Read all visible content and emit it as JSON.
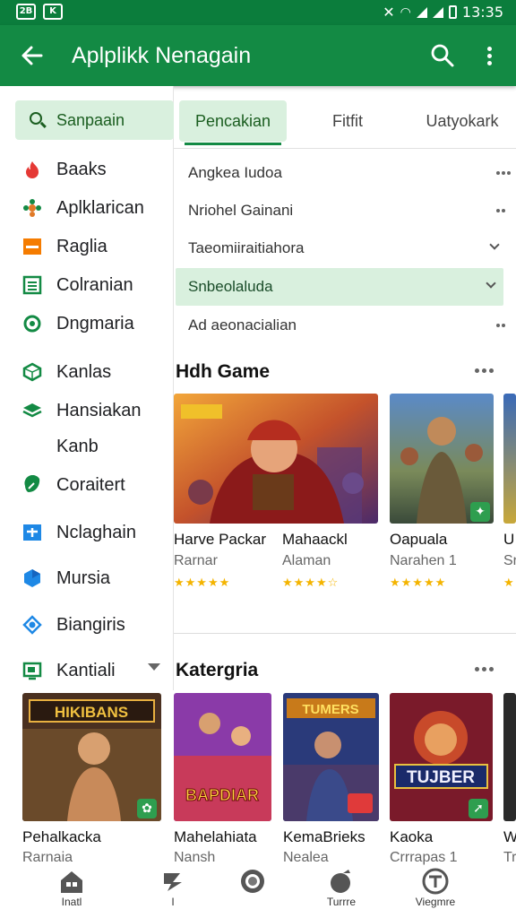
{
  "status_bar": {
    "left_icon_1": "2B",
    "left_icon_2": "K",
    "time": "13:35"
  },
  "app_bar": {
    "title": "Aplplikk Nenagain",
    "back_icon": "arrow-left-icon",
    "search_icon": "search-icon",
    "more_icon": "more-vert-icon"
  },
  "sidebar": {
    "search_label": "Sanpaain",
    "items": [
      {
        "label": "Baaks",
        "icon": "fire-icon",
        "color": "#e53935"
      },
      {
        "label": "Aplklarican",
        "icon": "flower-icon",
        "color": "#e07a27"
      },
      {
        "label": "Raglia",
        "icon": "minus-box-icon",
        "color": "#f57c00"
      },
      {
        "label": "Colranian",
        "icon": "list-icon",
        "color": "#138a44"
      },
      {
        "label": "Dngmaria",
        "icon": "circle-refresh-icon",
        "color": "#138a44"
      },
      {
        "label": "Kanlas",
        "icon": "cube-icon",
        "color": "#138a44"
      },
      {
        "label": "Hansiakan",
        "icon": "layers-icon",
        "color": "#138a44"
      },
      {
        "label": "Kanb",
        "icon": "",
        "color": ""
      },
      {
        "label": "Coraitert",
        "icon": "leaf-icon",
        "color": "#138a44"
      },
      {
        "label": "Nclaghain",
        "icon": "plus-box-icon",
        "color": "#1e88e5"
      },
      {
        "label": "Mursia",
        "icon": "hexagon-icon",
        "color": "#1e88e5"
      },
      {
        "label": "Biangiris",
        "icon": "diamond-eye-icon",
        "color": "#1e88e5"
      },
      {
        "label": "Kantiali",
        "icon": "monitor-icon",
        "color": "#138a44"
      }
    ]
  },
  "tabs": [
    {
      "label": "Pencakian",
      "active": true
    },
    {
      "label": "Fitfit",
      "active": false
    },
    {
      "label": "Uatyokark",
      "active": false
    }
  ],
  "filters": [
    {
      "label": "Angkea Iudoa",
      "control": "dots"
    },
    {
      "label": "Nriohel Gainani",
      "control": "dots"
    },
    {
      "label": "Taeomiiraitiahora",
      "control": "chevron"
    },
    {
      "label": "Snbeolaluda",
      "control": "chevron",
      "selected": true
    },
    {
      "label": "Ad aeonacialian",
      "control": "dots"
    }
  ],
  "section1": {
    "title": "Hdh Game",
    "cards": [
      {
        "name": "Harve Packar",
        "sub": "Rarnar",
        "stars": "★★★★★"
      },
      {
        "name": "Mahaackl",
        "sub": "Alaman",
        "stars": "★★★★☆"
      },
      {
        "name": "Oapuala",
        "sub": "Narahen 1",
        "stars": "★★★★★"
      },
      {
        "name": "U",
        "sub": "Sr",
        "stars": "★"
      }
    ]
  },
  "section2": {
    "title": "Katergria",
    "cards": [
      {
        "name": "Pehalkacka",
        "sub": "Rarnaia",
        "art_text": "HIKIBANS"
      },
      {
        "name": "Mahelahiata",
        "sub": "Nansh",
        "art_text": "BAPDIAR"
      },
      {
        "name": "KemaBrieks",
        "sub": "Nealea",
        "art_text": "TUMERS"
      },
      {
        "name": "Kaoka",
        "sub": "Crrrapas 1",
        "art_text": "TUJBER"
      },
      {
        "name": "W",
        "sub": "Tr",
        "art_text": ""
      }
    ]
  },
  "bottom_nav": [
    {
      "label": "Inatl",
      "icon": "home-icon"
    },
    {
      "label": "I",
      "icon": "chat-icon"
    },
    {
      "label": "",
      "icon": "record-icon"
    },
    {
      "label": "Turrre",
      "icon": "apple-icon"
    },
    {
      "label": "Viegmre",
      "icon": "profile-icon"
    }
  ],
  "colors": {
    "accent": "#138a44",
    "status_bar": "#0b7d3c",
    "selected_bg": "#d9f0de",
    "star": "#f4b400"
  }
}
